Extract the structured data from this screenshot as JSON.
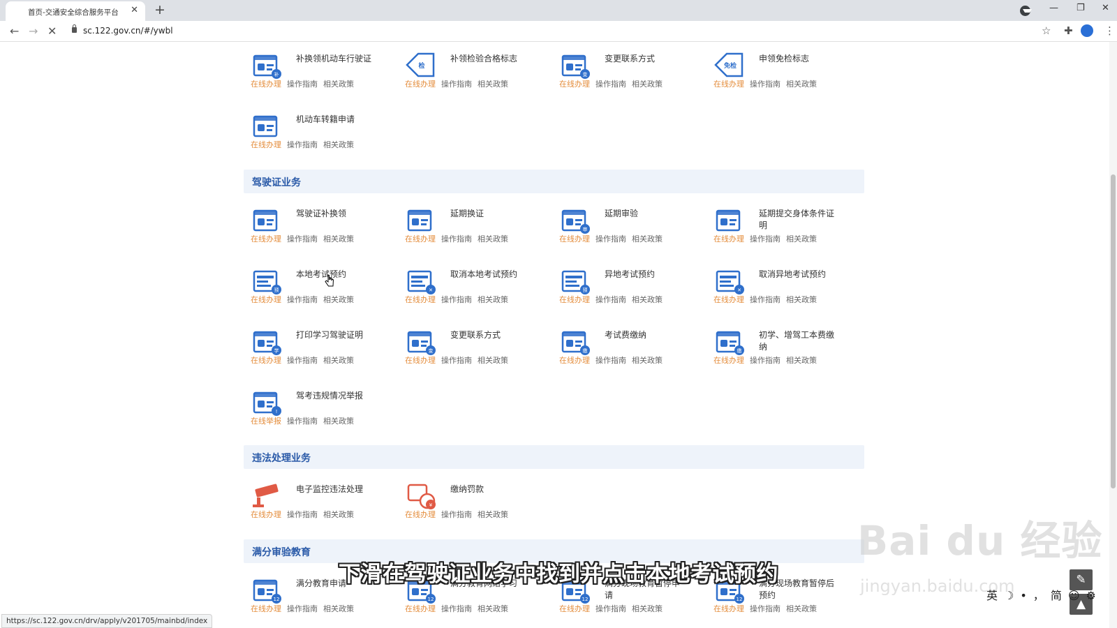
{
  "browser": {
    "tab_title": "首页-交通安全综合服务平台",
    "tab_close": "✕",
    "new_tab": "+",
    "url": "sc.122.gov.cn/#/ywbl",
    "status_url": "https://sc.122.gov.cn/drv/apply/v201705/mainbd/index",
    "window_controls": {
      "minimize": "—",
      "restore": "❐",
      "close": "✕"
    }
  },
  "link_labels": {
    "online": "在线办理",
    "report": "在线举报",
    "guide": "操作指南",
    "policy": "相关政策"
  },
  "vehicle_items": [
    {
      "title": "补换领机动车行驶证",
      "icon": "license-card-icon",
      "badge": "补",
      "primary": "在线办理"
    },
    {
      "title": "补领检验合格标志",
      "icon": "inspection-tag-icon",
      "badge": "检",
      "primary": "在线办理"
    },
    {
      "title": "变更联系方式",
      "icon": "contact-card-icon",
      "badge": "变",
      "primary": "在线办理"
    },
    {
      "title": "申领免检标志",
      "icon": "exempt-tag-icon",
      "badge": "免检",
      "primary": "在线办理"
    },
    {
      "title": "机动车转籍申请",
      "icon": "vehicle-transfer-icon",
      "badge": "",
      "primary": "在线办理"
    }
  ],
  "sections": {
    "driver": "驾驶证业务",
    "violation": "违法处理业务",
    "full_score": "满分审验教育"
  },
  "driver_items": [
    {
      "title": "驾驶证补换领",
      "icon": "id-card-icon",
      "badge": "",
      "primary": "在线办理"
    },
    {
      "title": "延期换证",
      "icon": "id-card-delay-icon",
      "badge": "",
      "primary": "在线办理"
    },
    {
      "title": "延期审验",
      "icon": "review-delay-icon",
      "badge": "审",
      "primary": "在线办理"
    },
    {
      "title": "延期提交身体条件证明",
      "icon": "health-cert-icon",
      "badge": "",
      "primary": "在线办理"
    },
    {
      "title": "本地考试预约",
      "icon": "exam-booking-icon",
      "badge": "预",
      "primary": "在线办理"
    },
    {
      "title": "取消本地考试预约",
      "icon": "calendar-cancel-icon",
      "badge": "✕",
      "primary": "在线办理"
    },
    {
      "title": "异地考试预约",
      "icon": "remote-exam-booking-icon",
      "badge": "预",
      "primary": "在线办理"
    },
    {
      "title": "取消异地考试预约",
      "icon": "remote-calendar-cancel-icon",
      "badge": "✕",
      "primary": "在线办理"
    },
    {
      "title": "打印学习驾驶证明",
      "icon": "learner-cert-icon",
      "badge": "学",
      "primary": "在线办理"
    },
    {
      "title": "变更联系方式",
      "icon": "contact-card-icon",
      "badge": "变",
      "primary": "在线办理"
    },
    {
      "title": "考试费缴纳",
      "icon": "exam-fee-icon",
      "badge": "缴",
      "primary": "在线办理"
    },
    {
      "title": "初学、增驾工本费缴纳",
      "icon": "cost-fee-icon",
      "badge": "缴",
      "primary": "在线办理"
    },
    {
      "title": "驾考违规情况举报",
      "icon": "report-icon",
      "badge": "!",
      "primary": "在线举报"
    }
  ],
  "violation_items": [
    {
      "title": "电子监控违法处理",
      "icon": "camera-icon",
      "badge": "",
      "primary": "在线办理"
    },
    {
      "title": "缴纳罚款",
      "icon": "fine-payment-icon",
      "badge": "¥",
      "primary": "在线办理"
    }
  ],
  "full_score_items": [
    {
      "title": "满分教育申请",
      "icon": "apply-icon",
      "badge": "12",
      "primary": "在线办理"
    },
    {
      "title": "满分教育网络学习",
      "icon": "online-study-icon",
      "badge": "12",
      "primary": "在线办理"
    },
    {
      "title": "满分现场教育暂停申请",
      "icon": "pause-apply-icon",
      "badge": "12",
      "primary": "在线办理"
    },
    {
      "title": "满分现场教育暂停后预约",
      "icon": "resume-booking-icon",
      "badge": "12",
      "primary": "在线办理"
    }
  ],
  "caption": "下滑在驾驶证业务中找到并点击本地考试预约",
  "watermark": {
    "main": "Bai du 经验",
    "sub": "jingyan.baidu.com"
  },
  "ime": [
    "英",
    "☽",
    "•",
    "，",
    "简",
    "☺",
    "⚙"
  ],
  "colors": {
    "accent": "#e48d3c",
    "section_title": "#2a5aa8",
    "icon_blue": "#2f6fcb",
    "icon_red": "#e05a45"
  }
}
